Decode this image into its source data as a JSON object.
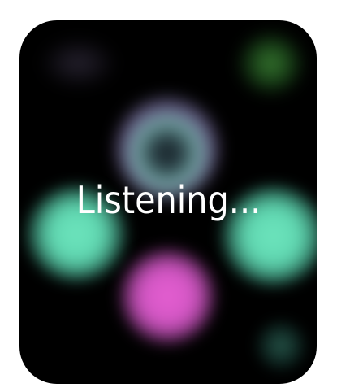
{
  "screen": {
    "status_text": "Listening..."
  },
  "colors": {
    "background": "#000000",
    "orb_green": "#6EE6BE",
    "orb_pink": "#E65FD2",
    "orb_top_teal": "#8CCDC8",
    "orb_top_purple": "#B48CE6",
    "accent_dim_green": "#46963C"
  },
  "icons": [
    "voice-orb-animation"
  ]
}
